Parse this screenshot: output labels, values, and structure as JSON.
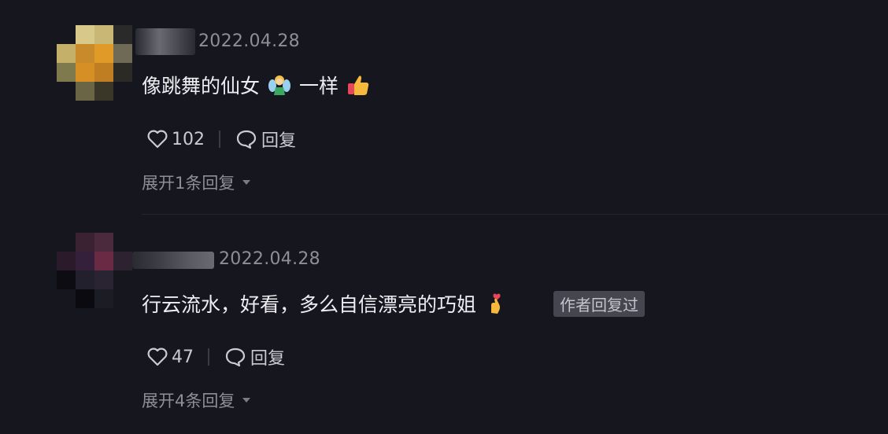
{
  "comments": [
    {
      "date": "2022.04.28",
      "text_before": "像跳舞的仙女",
      "emoji1": "fairy-emoji",
      "text_mid": "一样",
      "emoji2": "thumbs-up-emoji",
      "likes": "102",
      "reply_label": "回复",
      "expand_label": "展开1条回复"
    },
    {
      "date": "2022.04.28",
      "text": "行云流水，好看，多么自信漂亮的巧姐",
      "emoji": "finger-heart-emoji",
      "badge": "作者回复过",
      "likes": "47",
      "reply_label": "回复",
      "expand_label": "展开4条回复"
    }
  ],
  "colors": {
    "background": "#16161e",
    "text_primary": "#eeeef2",
    "text_secondary": "#8d8e97",
    "badge_bg": "#45464f"
  }
}
